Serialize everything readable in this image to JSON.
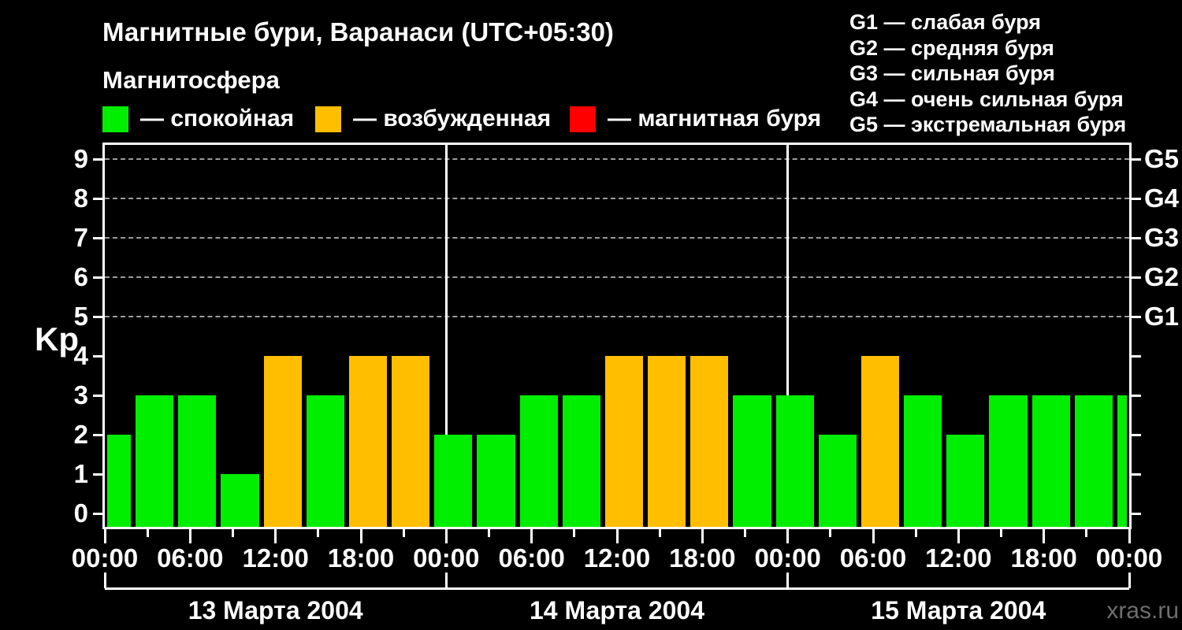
{
  "title": "Магнитные бури, Варанаси (UTC+05:30)",
  "subtitle": "Магнитосфера",
  "legend": {
    "items": [
      {
        "state": "quiet",
        "label": "— спокойная"
      },
      {
        "state": "unsettled",
        "label": "— возбужденная"
      },
      {
        "state": "storm",
        "label": "— магнитная буря"
      }
    ]
  },
  "g_scale_legend": {
    "lines": [
      "G1 — слабая буря",
      "G2 — средняя буря",
      "G3 — сильная буря",
      "G4 — очень сильная буря",
      "G5 — экстремальная буря"
    ]
  },
  "watermark": "xras.ru",
  "colors": {
    "background": "#000000",
    "frame": "#ffffff",
    "grid": "#9c9c9c",
    "text": "#ffffff",
    "watermark": "#6e6e6e"
  },
  "chart_data": {
    "type": "bar",
    "title": "Магнитные бури, Варанаси (UTC+05:30)",
    "ylabel": "Kp",
    "xlabel": "",
    "ylim": [
      0,
      9
    ],
    "grid": "dashed horizontal at levels 5-9",
    "legend_position": "top",
    "x_total_hours": 72,
    "yticks": [
      0,
      1,
      2,
      3,
      4,
      5,
      6,
      7,
      8,
      9
    ],
    "grid_levels": [
      5,
      6,
      7,
      8,
      9
    ],
    "right_axis": [
      {
        "level": 5,
        "label": "G1"
      },
      {
        "level": 6,
        "label": "G2"
      },
      {
        "level": 7,
        "label": "G3"
      },
      {
        "level": 8,
        "label": "G4"
      },
      {
        "level": 9,
        "label": "G5"
      }
    ],
    "xticks": [
      {
        "hour": 0,
        "label": "00:00"
      },
      {
        "hour": 6,
        "label": "06:00"
      },
      {
        "hour": 12,
        "label": "12:00"
      },
      {
        "hour": 18,
        "label": "18:00"
      },
      {
        "hour": 24,
        "label": "00:00"
      },
      {
        "hour": 30,
        "label": "06:00"
      },
      {
        "hour": 36,
        "label": "12:00"
      },
      {
        "hour": 42,
        "label": "18:00"
      },
      {
        "hour": 48,
        "label": "00:00"
      },
      {
        "hour": 54,
        "label": "06:00"
      },
      {
        "hour": 60,
        "label": "12:00"
      },
      {
        "hour": 66,
        "label": "18:00"
      },
      {
        "hour": 72,
        "label": "00:00"
      }
    ],
    "minor_tick_hours": [
      3,
      9,
      15,
      21,
      27,
      33,
      39,
      45,
      51,
      57,
      63,
      69
    ],
    "day_separator_hours": [
      24,
      48
    ],
    "days": [
      {
        "label": "13 Марта 2004",
        "start_hour": 0,
        "end_hour": 24
      },
      {
        "label": "14 Марта 2004",
        "start_hour": 24,
        "end_hour": 48
      },
      {
        "label": "15 Марта 2004",
        "start_hour": 48,
        "end_hour": 72
      }
    ],
    "state_colors": {
      "quiet": "#00ee00",
      "unsettled": "#ffbe00",
      "storm": "#ff0000"
    },
    "bars": [
      {
        "start_hour": 0,
        "end_hour": 2,
        "kp": 2,
        "state": "quiet"
      },
      {
        "start_hour": 2,
        "end_hour": 5,
        "kp": 3,
        "state": "quiet"
      },
      {
        "start_hour": 5,
        "end_hour": 8,
        "kp": 3,
        "state": "quiet"
      },
      {
        "start_hour": 8,
        "end_hour": 11,
        "kp": 1,
        "state": "quiet"
      },
      {
        "start_hour": 11,
        "end_hour": 14,
        "kp": 4,
        "state": "unsettled"
      },
      {
        "start_hour": 14,
        "end_hour": 17,
        "kp": 3,
        "state": "quiet"
      },
      {
        "start_hour": 17,
        "end_hour": 20,
        "kp": 4,
        "state": "unsettled"
      },
      {
        "start_hour": 20,
        "end_hour": 23,
        "kp": 4,
        "state": "unsettled"
      },
      {
        "start_hour": 23,
        "end_hour": 26,
        "kp": 2,
        "state": "quiet"
      },
      {
        "start_hour": 26,
        "end_hour": 29,
        "kp": 2,
        "state": "quiet"
      },
      {
        "start_hour": 29,
        "end_hour": 32,
        "kp": 3,
        "state": "quiet"
      },
      {
        "start_hour": 32,
        "end_hour": 35,
        "kp": 3,
        "state": "quiet"
      },
      {
        "start_hour": 35,
        "end_hour": 38,
        "kp": 4,
        "state": "unsettled"
      },
      {
        "start_hour": 38,
        "end_hour": 41,
        "kp": 4,
        "state": "unsettled"
      },
      {
        "start_hour": 41,
        "end_hour": 44,
        "kp": 4,
        "state": "unsettled"
      },
      {
        "start_hour": 44,
        "end_hour": 47,
        "kp": 3,
        "state": "quiet"
      },
      {
        "start_hour": 47,
        "end_hour": 50,
        "kp": 3,
        "state": "quiet"
      },
      {
        "start_hour": 50,
        "end_hour": 53,
        "kp": 2,
        "state": "quiet"
      },
      {
        "start_hour": 53,
        "end_hour": 56,
        "kp": 4,
        "state": "unsettled"
      },
      {
        "start_hour": 56,
        "end_hour": 59,
        "kp": 3,
        "state": "quiet"
      },
      {
        "start_hour": 59,
        "end_hour": 62,
        "kp": 2,
        "state": "quiet"
      },
      {
        "start_hour": 62,
        "end_hour": 65,
        "kp": 3,
        "state": "quiet"
      },
      {
        "start_hour": 65,
        "end_hour": 68,
        "kp": 3,
        "state": "quiet"
      },
      {
        "start_hour": 68,
        "end_hour": 71,
        "kp": 3,
        "state": "quiet"
      },
      {
        "start_hour": 71,
        "end_hour": 72,
        "kp": 3,
        "state": "quiet"
      }
    ]
  }
}
